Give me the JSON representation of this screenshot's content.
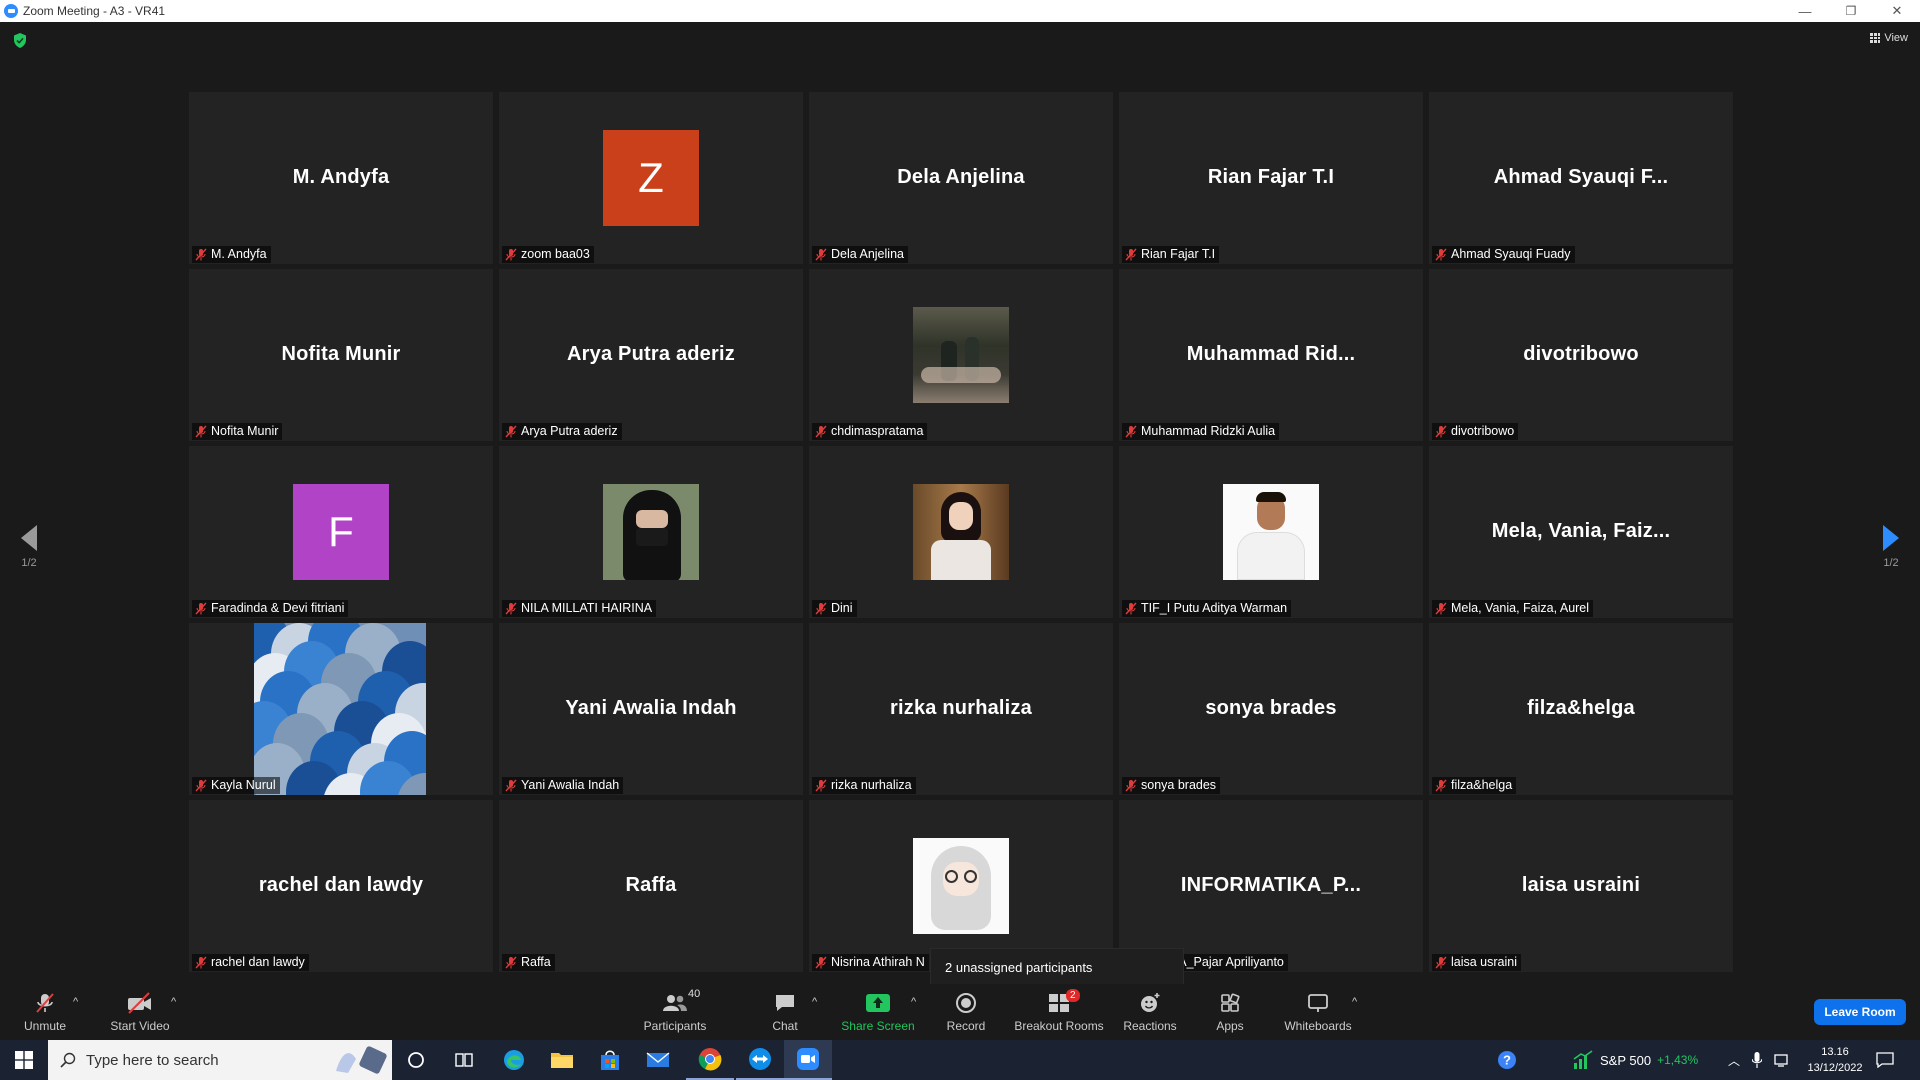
{
  "window": {
    "title": "Zoom Meeting - A3 - VR41",
    "minimize": "—",
    "maximize": "❐",
    "close": "✕"
  },
  "meeting": {
    "view_label": "View",
    "left_page": "1/2",
    "right_page": "1/2",
    "unassigned_tooltip": "2 unassigned participants"
  },
  "participants": [
    {
      "big": "M. Andyfa",
      "label": "M. Andyfa"
    },
    {
      "big": "",
      "label": "zoom baa03",
      "avatar_letter": "Z",
      "avatar_color": "#c9401a"
    },
    {
      "big": "Dela Anjelina",
      "label": "Dela Anjelina"
    },
    {
      "big": "Rian Fajar T.I",
      "label": "Rian Fajar T.I"
    },
    {
      "big": "Ahmad  Syauqi  F...",
      "label": "Ahmad Syauqi Fuady"
    },
    {
      "big": "Nofita Munir",
      "label": "Nofita Munir"
    },
    {
      "big": "Arya Putra aderiz",
      "label": "Arya Putra aderiz"
    },
    {
      "big": "",
      "label": "chdimaspratama",
      "photo": "night-street-photo"
    },
    {
      "big": "Muhammad  Rid...",
      "label": "Muhammad Ridzki Aulia"
    },
    {
      "big": "divotribowo",
      "label": "divotribowo"
    },
    {
      "big": "",
      "label": "Faradinda & Devi fitriani",
      "avatar_letter": "F",
      "avatar_color": "#b043c6"
    },
    {
      "big": "",
      "label": "NILA MILLATI HAIRINA",
      "photo": "hijab-mask-photo"
    },
    {
      "big": "",
      "label": "Dini",
      "photo": "girl-headphones-photo"
    },
    {
      "big": "",
      "label": "TIF_I Putu Aditya Warman",
      "photo": "man-white-shirt-photo"
    },
    {
      "big": "Mela,  Vania,  Faiz...",
      "label": "Mela, Vania, Faiza, Aurel"
    },
    {
      "big": "",
      "label": "Kayla Nurul",
      "photo": "blue-balloons-photo"
    },
    {
      "big": "Yani Awalia Indah",
      "label": "Yani Awalia Indah"
    },
    {
      "big": "rizka nurhaliza",
      "label": "rizka nurhaliza"
    },
    {
      "big": "sonya brades",
      "label": "sonya brades"
    },
    {
      "big": "filza&helga",
      "label": "filza&helga"
    },
    {
      "big": "rachel dan lawdy",
      "label": "rachel dan lawdy"
    },
    {
      "big": "Raffa",
      "label": "Raffa"
    },
    {
      "big": "",
      "label": "Nisrina Athirah N",
      "photo": "hijab-cartoon-avatar"
    },
    {
      "big": "INFORMATIKA_P...",
      "label": "MATIKA_Pajar Apriliyanto"
    },
    {
      "big": "laisa usraini",
      "label": "laisa usraini"
    }
  ],
  "toolbar": {
    "unmute": "Unmute",
    "start_video": "Start Video",
    "participants": "Participants",
    "participants_count": "40",
    "chat": "Chat",
    "share_screen": "Share Screen",
    "record": "Record",
    "breakout_rooms": "Breakout Rooms",
    "breakout_badge": "2",
    "reactions": "Reactions",
    "apps": "Apps",
    "whiteboards": "Whiteboards",
    "leave": "Leave Room",
    "caret": "^"
  },
  "taskbar": {
    "search_placeholder": "Type here to search",
    "stock_name": "S&P 500",
    "stock_change": "+1,43%",
    "time": "13.16",
    "date": "13/12/2022"
  },
  "colors": {
    "accent": "#0e72ed",
    "share_green": "#22c55e",
    "muted_red": "#e03c3c"
  }
}
